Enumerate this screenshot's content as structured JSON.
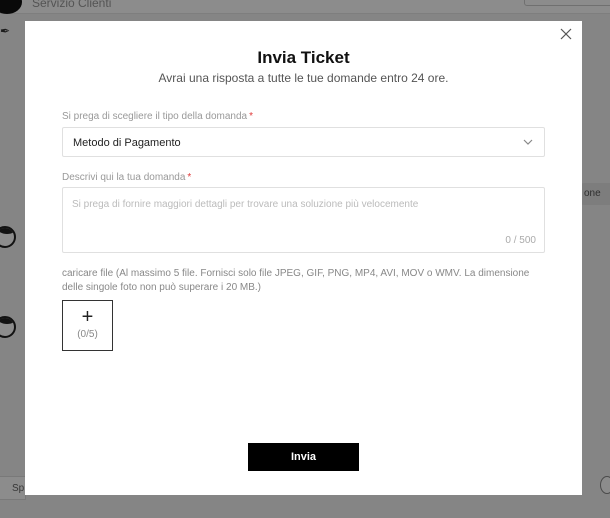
{
  "background": {
    "header_title": "Servizio Clienti",
    "right_chip": "one",
    "bottom_input": "Sp"
  },
  "modal": {
    "close_icon": "close-icon",
    "title": "Invia Ticket",
    "subtitle": "Avrai una risposta a tutte le tue domande entro 24 ore.",
    "type_field": {
      "label": "Si prega di scegliere il tipo della domanda",
      "required_mark": "*",
      "value": "Metodo di Pagamento"
    },
    "description_field": {
      "label": "Descrivi qui la tua domanda",
      "required_mark": "*",
      "placeholder": "Si prega di fornire maggiori dettagli per trovare una soluzione più velocemente",
      "value": "",
      "counter": "0 / 500"
    },
    "upload": {
      "note": "caricare file (Al massimo 5 file. Fornisci solo file JPEG, GIF, PNG, MP4, AVI, MOV o WMV. La dimensione delle singole foto non può superare i 20 MB.)",
      "plus": "+",
      "count": "(0/5)"
    },
    "submit_label": "Invia"
  },
  "colors": {
    "overlay": "#000000",
    "required": "#e03a3a",
    "button_bg": "#000000",
    "button_text": "#ffffff"
  }
}
